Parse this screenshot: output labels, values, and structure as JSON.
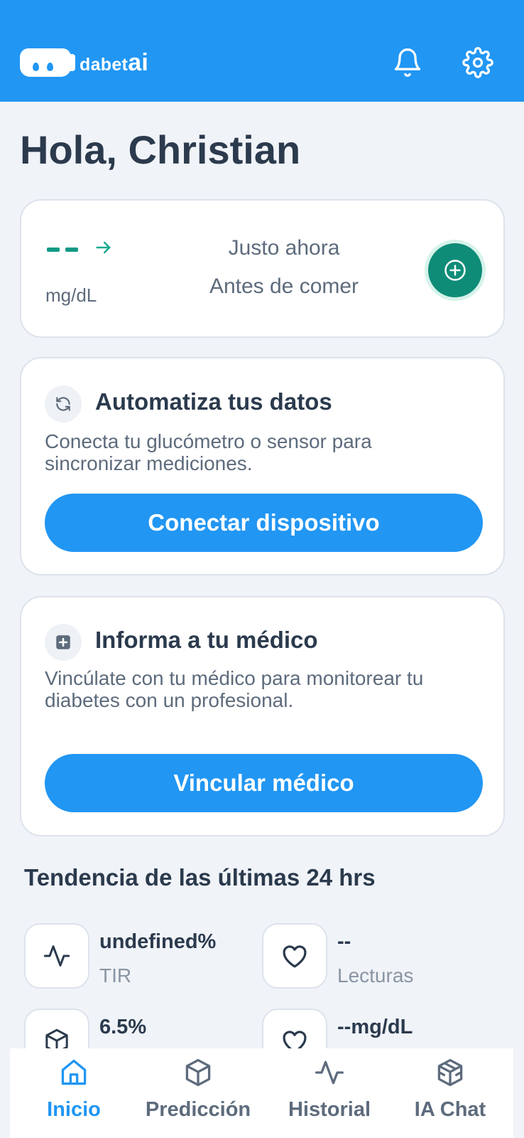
{
  "header": {
    "logo_text": "dabet",
    "logo_accent": "ai",
    "brand_color": "#2196f3",
    "icons": [
      "bell-icon",
      "gear-icon"
    ]
  },
  "greeting": "Hola, Christian",
  "glucose": {
    "unit": "mg/dL",
    "time": "Justo ahora",
    "context": "Antes de comer",
    "trend_icon": "arrow-right-icon",
    "add_icon": "plus-circle-icon"
  },
  "automate": {
    "title": "Automatiza tus datos",
    "description": "Conecta tu glucómetro o sensor para sincronizar mediciones.",
    "button": "Conectar dispositivo",
    "icon": "sync-icon"
  },
  "doctor": {
    "title": "Informa a tu médico",
    "description": "Vincúlate con tu médico para monitorear tu diabetes con un profesional.",
    "button": "Vincular médico",
    "icon": "medical-plus-icon"
  },
  "trends": {
    "title": "Tendencia de las últimas 24 hrs",
    "stats": [
      {
        "value": "undefined%",
        "label": "TIR",
        "icon": "activity-icon"
      },
      {
        "value": "--",
        "label": "Lecturas",
        "icon": "heart-icon"
      },
      {
        "value": "6.5%",
        "label": "",
        "icon": "cube-icon"
      },
      {
        "value": "--mg/dL",
        "label": "",
        "icon": "heart-icon"
      }
    ]
  },
  "nav": {
    "items": [
      {
        "label": "Inicio",
        "icon": "home-icon",
        "active": true
      },
      {
        "label": "Predicción",
        "icon": "cube-icon",
        "active": false
      },
      {
        "label": "Historial",
        "icon": "activity-icon",
        "active": false
      },
      {
        "label": "IA Chat",
        "icon": "boxes-icon",
        "active": false
      }
    ]
  }
}
